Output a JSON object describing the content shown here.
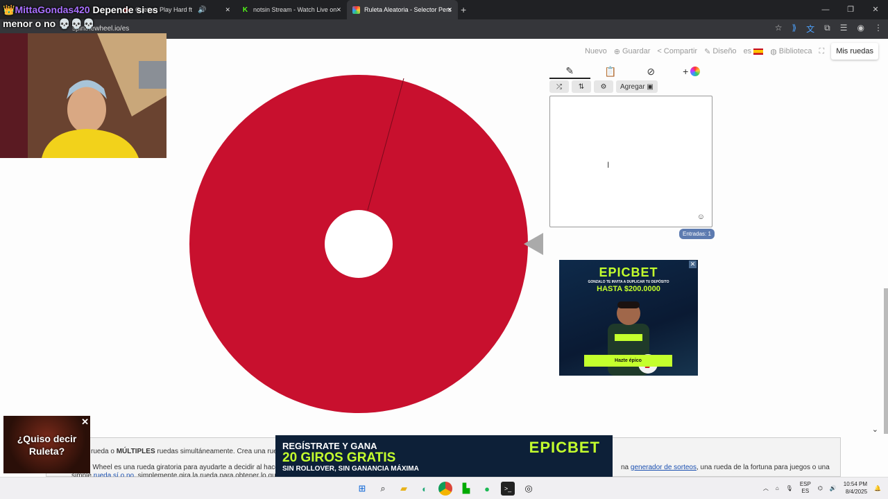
{
  "overlay": {
    "username": "MittaGondas420",
    "message_part1": "Depende si es",
    "message_part2": "menor o no 💀💀💀",
    "roulette_card_line1": "¿Quiso decir",
    "roulette_card_line2": "Ruleta?"
  },
  "browser": {
    "tabs": [
      {
        "label": "",
        "icon": "sound-tab-icon"
      },
      {
        "label": "Guetta - Play Hard ft",
        "icon": "youtube-icon"
      },
      {
        "label": "notsin Stream - Watch Live on",
        "icon": "kick-icon"
      },
      {
        "label": "Ruleta Aleatoria - Selector Pers",
        "icon": "wheel-favicon"
      }
    ],
    "url": "spinthewheel.io/es"
  },
  "nav": {
    "nuevo": "Nuevo",
    "guardar": "Guardar",
    "compartir": "Compartir",
    "diseno": "Diseño",
    "lang": "es",
    "biblioteca": "Biblioteca",
    "mis_ruedas": "Mis ruedas"
  },
  "editor": {
    "agregar": "Agregar",
    "entries_badge": "Entradas: 1"
  },
  "wheel": {
    "color": "#c8102e",
    "entries_count": 1
  },
  "ad_side": {
    "brand": "EPICBET",
    "sub": "GONZALO TE INVITA A DUPLICAR TU DEPÓSITO",
    "prize": "HASTA $200.0000",
    "cta": "Hazte épico"
  },
  "ad_bottom": {
    "line1": "REGÍSTRATE Y GANA",
    "line2": "20 GIROS GRATIS",
    "line3": "SIN ROLLOVER, SIN GANANCIA MÁXIMA",
    "brand": "EPICBET"
  },
  "page_text": {
    "line1_a": "rueda o ",
    "line1_b": "MÚLTIPLES",
    "line1_c": " ruedas simultáneamente. Crea una rueda pe",
    "line2": "e Wheel es una rueda giratoria para ayudarte a decidir al hacer u",
    "line2_link_prefix": "na ",
    "line2_link": "generador de sorteos",
    "line2_rest": ", una rueda de la fortuna para juegos o una",
    "line3_a": "simple ",
    "line3_link": "rueda sí o no",
    "line3_b": ", simplemente gira la rueda para obtener lo que nec"
  },
  "taskbar": {
    "lang_line1": "ESP",
    "lang_line2": "ES",
    "time": "10:54 PM",
    "date": "8/4/2025"
  }
}
